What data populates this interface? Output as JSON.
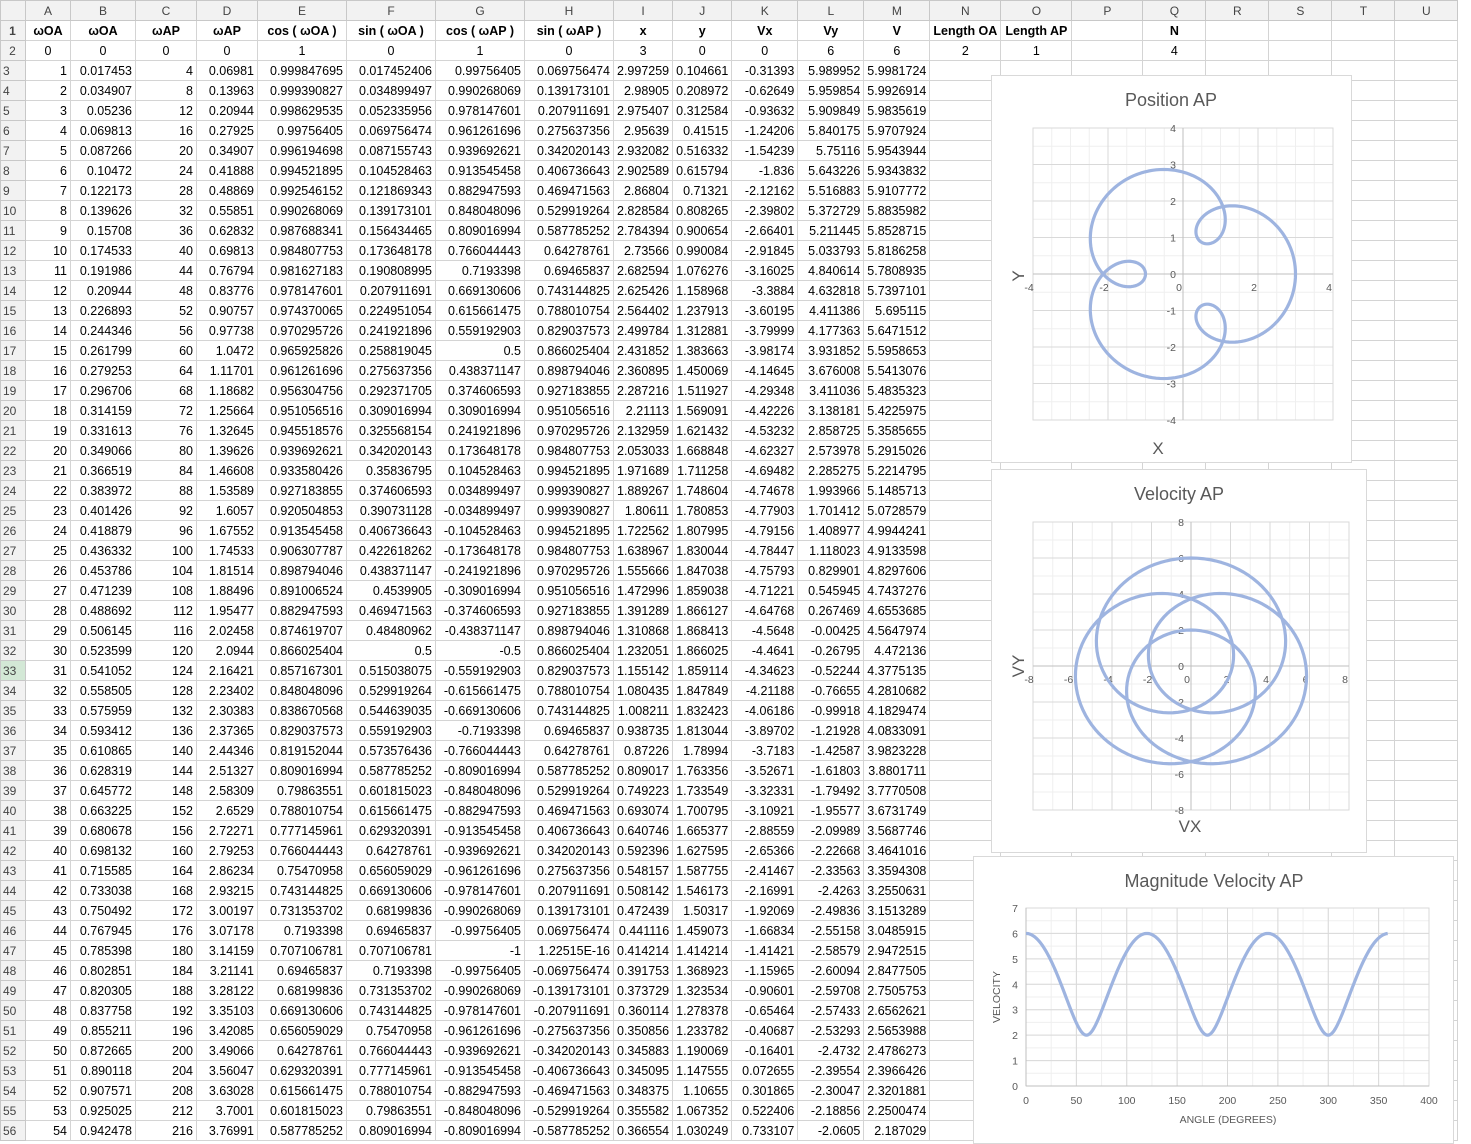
{
  "columns": [
    "A",
    "B",
    "C",
    "D",
    "E",
    "F",
    "G",
    "H",
    "I",
    "J",
    "K",
    "L",
    "M",
    "N",
    "O",
    "P",
    "Q",
    "R",
    "S",
    "T",
    "U"
  ],
  "selected_row": "33",
  "header_row": {
    "num": "1",
    "cells": [
      "ωOA",
      "ωOA",
      "ωAP",
      "ωAP",
      "cos ( ωOA )",
      "sin ( ωOA )",
      "cos ( ωAP )",
      "sin ( ωAP )",
      "x",
      "y",
      "Vx",
      "Vy",
      "V",
      "Length OA",
      "Length  AP",
      "",
      "N",
      "",
      "",
      "",
      ""
    ]
  },
  "row2": {
    "num": "2",
    "cells": [
      "0",
      "0",
      "0",
      "0",
      "1",
      "0",
      "1",
      "0",
      "3",
      "0",
      "0",
      "6",
      "6",
      "2",
      "1",
      "",
      "4",
      "",
      "",
      "",
      ""
    ]
  },
  "rows": [
    [
      "3",
      "1",
      "0.017453",
      "4",
      "0.06981",
      "0.999847695",
      "0.017452406",
      "0.99756405",
      "0.069756474",
      "2.997259",
      "0.104661",
      "-0.31393",
      "5.989952",
      "5.9981724"
    ],
    [
      "4",
      "2",
      "0.034907",
      "8",
      "0.13963",
      "0.999390827",
      "0.034899497",
      "0.990268069",
      "0.139173101",
      "2.98905",
      "0.208972",
      "-0.62649",
      "5.959854",
      "5.9926914"
    ],
    [
      "5",
      "3",
      "0.05236",
      "12",
      "0.20944",
      "0.998629535",
      "0.052335956",
      "0.978147601",
      "0.207911691",
      "2.975407",
      "0.312584",
      "-0.93632",
      "5.909849",
      "5.9835619"
    ],
    [
      "6",
      "4",
      "0.069813",
      "16",
      "0.27925",
      "0.99756405",
      "0.069756474",
      "0.961261696",
      "0.275637356",
      "2.95639",
      "0.41515",
      "-1.24206",
      "5.840175",
      "5.9707924"
    ],
    [
      "7",
      "5",
      "0.087266",
      "20",
      "0.34907",
      "0.996194698",
      "0.087155743",
      "0.939692621",
      "0.342020143",
      "2.932082",
      "0.516332",
      "-1.54239",
      "5.75116",
      "5.9543944"
    ],
    [
      "8",
      "6",
      "0.10472",
      "24",
      "0.41888",
      "0.994521895",
      "0.104528463",
      "0.913545458",
      "0.406736643",
      "2.902589",
      "0.615794",
      "-1.836",
      "5.643226",
      "5.9343832"
    ],
    [
      "9",
      "7",
      "0.122173",
      "28",
      "0.48869",
      "0.992546152",
      "0.121869343",
      "0.882947593",
      "0.469471563",
      "2.86804",
      "0.71321",
      "-2.12162",
      "5.516883",
      "5.9107772"
    ],
    [
      "10",
      "8",
      "0.139626",
      "32",
      "0.55851",
      "0.990268069",
      "0.139173101",
      "0.848048096",
      "0.529919264",
      "2.828584",
      "0.808265",
      "-2.39802",
      "5.372729",
      "5.8835982"
    ],
    [
      "11",
      "9",
      "0.15708",
      "36",
      "0.62832",
      "0.987688341",
      "0.156434465",
      "0.809016994",
      "0.587785252",
      "2.784394",
      "0.900654",
      "-2.66401",
      "5.211445",
      "5.8528715"
    ],
    [
      "12",
      "10",
      "0.174533",
      "40",
      "0.69813",
      "0.984807753",
      "0.173648178",
      "0.766044443",
      "0.64278761",
      "2.73566",
      "0.990084",
      "-2.91845",
      "5.033793",
      "5.8186258"
    ],
    [
      "13",
      "11",
      "0.191986",
      "44",
      "0.76794",
      "0.981627183",
      "0.190808995",
      "0.7193398",
      "0.69465837",
      "2.682594",
      "1.076276",
      "-3.16025",
      "4.840614",
      "5.7808935"
    ],
    [
      "14",
      "12",
      "0.20944",
      "48",
      "0.83776",
      "0.978147601",
      "0.207911691",
      "0.669130606",
      "0.743144825",
      "2.625426",
      "1.158968",
      "-3.3884",
      "4.632818",
      "5.7397101"
    ],
    [
      "15",
      "13",
      "0.226893",
      "52",
      "0.90757",
      "0.974370065",
      "0.224951054",
      "0.615661475",
      "0.788010754",
      "2.564402",
      "1.237913",
      "-3.60195",
      "4.411386",
      "5.695115"
    ],
    [
      "16",
      "14",
      "0.244346",
      "56",
      "0.97738",
      "0.970295726",
      "0.241921896",
      "0.559192903",
      "0.829037573",
      "2.499784",
      "1.312881",
      "-3.79999",
      "4.177363",
      "5.6471512"
    ],
    [
      "17",
      "15",
      "0.261799",
      "60",
      "1.0472",
      "0.965925826",
      "0.258819045",
      "0.5",
      "0.866025404",
      "2.431852",
      "1.383663",
      "-3.98174",
      "3.931852",
      "5.5958653"
    ],
    [
      "18",
      "16",
      "0.279253",
      "64",
      "1.11701",
      "0.961261696",
      "0.275637356",
      "0.438371147",
      "0.898794046",
      "2.360895",
      "1.450069",
      "-4.14645",
      "3.676008",
      "5.5413076"
    ],
    [
      "19",
      "17",
      "0.296706",
      "68",
      "1.18682",
      "0.956304756",
      "0.292371705",
      "0.374606593",
      "0.927183855",
      "2.287216",
      "1.511927",
      "-4.29348",
      "3.411036",
      "5.4835323"
    ],
    [
      "20",
      "18",
      "0.314159",
      "72",
      "1.25664",
      "0.951056516",
      "0.309016994",
      "0.309016994",
      "0.951056516",
      "2.21113",
      "1.569091",
      "-4.42226",
      "3.138181",
      "5.4225975"
    ],
    [
      "21",
      "19",
      "0.331613",
      "76",
      "1.32645",
      "0.945518576",
      "0.325568154",
      "0.241921896",
      "0.970295726",
      "2.132959",
      "1.621432",
      "-4.53232",
      "2.858725",
      "5.3585655"
    ],
    [
      "22",
      "20",
      "0.349066",
      "80",
      "1.39626",
      "0.939692621",
      "0.342020143",
      "0.173648178",
      "0.984807753",
      "2.053033",
      "1.668848",
      "-4.62327",
      "2.573978",
      "5.2915026"
    ],
    [
      "23",
      "21",
      "0.366519",
      "84",
      "1.46608",
      "0.933580426",
      "0.35836795",
      "0.104528463",
      "0.994521895",
      "1.971689",
      "1.711258",
      "-4.69482",
      "2.285275",
      "5.2214795"
    ],
    [
      "24",
      "22",
      "0.383972",
      "88",
      "1.53589",
      "0.927183855",
      "0.374606593",
      "0.034899497",
      "0.999390827",
      "1.889267",
      "1.748604",
      "-4.74678",
      "1.993966",
      "5.1485713"
    ],
    [
      "25",
      "23",
      "0.401426",
      "92",
      "1.6057",
      "0.920504853",
      "0.390731128",
      "-0.034899497",
      "0.999390827",
      "1.80611",
      "1.780853",
      "-4.77903",
      "1.701412",
      "5.0728579"
    ],
    [
      "26",
      "24",
      "0.418879",
      "96",
      "1.67552",
      "0.913545458",
      "0.406736643",
      "-0.104528463",
      "0.994521895",
      "1.722562",
      "1.807995",
      "-4.79156",
      "1.408977",
      "4.9944241"
    ],
    [
      "27",
      "25",
      "0.436332",
      "100",
      "1.74533",
      "0.906307787",
      "0.422618262",
      "-0.173648178",
      "0.984807753",
      "1.638967",
      "1.830044",
      "-4.78447",
      "1.118023",
      "4.9133598"
    ],
    [
      "28",
      "26",
      "0.453786",
      "104",
      "1.81514",
      "0.898794046",
      "0.438371147",
      "-0.241921896",
      "0.970295726",
      "1.555666",
      "1.847038",
      "-4.75793",
      "0.829901",
      "4.8297606"
    ],
    [
      "29",
      "27",
      "0.471239",
      "108",
      "1.88496",
      "0.891006524",
      "0.4539905",
      "-0.309016994",
      "0.951056516",
      "1.472996",
      "1.859038",
      "-4.71221",
      "0.545945",
      "4.7437276"
    ],
    [
      "30",
      "28",
      "0.488692",
      "112",
      "1.95477",
      "0.882947593",
      "0.469471563",
      "-0.374606593",
      "0.927183855",
      "1.391289",
      "1.866127",
      "-4.64768",
      "0.267469",
      "4.6553685"
    ],
    [
      "31",
      "29",
      "0.506145",
      "116",
      "2.02458",
      "0.874619707",
      "0.48480962",
      "-0.438371147",
      "0.898794046",
      "1.310868",
      "1.868413",
      "-4.5648",
      "-0.00425",
      "4.5647974"
    ],
    [
      "32",
      "30",
      "0.523599",
      "120",
      "2.0944",
      "0.866025404",
      "0.5",
      "-0.5",
      "0.866025404",
      "1.232051",
      "1.866025",
      "-4.4641",
      "-0.26795",
      "4.472136"
    ],
    [
      "33",
      "31",
      "0.541052",
      "124",
      "2.16421",
      "0.857167301",
      "0.515038075",
      "-0.559192903",
      "0.829037573",
      "1.155142",
      "1.859114",
      "-4.34623",
      "-0.52244",
      "4.3775135"
    ],
    [
      "34",
      "32",
      "0.558505",
      "128",
      "2.23402",
      "0.848048096",
      "0.529919264",
      "-0.615661475",
      "0.788010754",
      "1.080435",
      "1.847849",
      "-4.21188",
      "-0.76655",
      "4.2810682"
    ],
    [
      "35",
      "33",
      "0.575959",
      "132",
      "2.30383",
      "0.838670568",
      "0.544639035",
      "-0.669130606",
      "0.743144825",
      "1.008211",
      "1.832423",
      "-4.06186",
      "-0.99918",
      "4.1829474"
    ],
    [
      "36",
      "34",
      "0.593412",
      "136",
      "2.37365",
      "0.829037573",
      "0.559192903",
      "-0.7193398",
      "0.69465837",
      "0.938735",
      "1.813044",
      "-3.89702",
      "-1.21928",
      "4.0833091"
    ],
    [
      "37",
      "35",
      "0.610865",
      "140",
      "2.44346",
      "0.819152044",
      "0.573576436",
      "-0.766044443",
      "0.64278761",
      "0.87226",
      "1.78994",
      "-3.7183",
      "-1.42587",
      "3.9823228"
    ],
    [
      "38",
      "36",
      "0.628319",
      "144",
      "2.51327",
      "0.809016994",
      "0.587785252",
      "-0.809016994",
      "0.587785252",
      "0.809017",
      "1.763356",
      "-3.52671",
      "-1.61803",
      "3.8801711"
    ],
    [
      "39",
      "37",
      "0.645772",
      "148",
      "2.58309",
      "0.79863551",
      "0.601815023",
      "-0.848048096",
      "0.529919264",
      "0.749223",
      "1.733549",
      "-3.32331",
      "-1.79492",
      "3.7770508"
    ],
    [
      "40",
      "38",
      "0.663225",
      "152",
      "2.6529",
      "0.788010754",
      "0.615661475",
      "-0.882947593",
      "0.469471563",
      "0.693074",
      "1.700795",
      "-3.10921",
      "-1.95577",
      "3.6731749"
    ],
    [
      "41",
      "39",
      "0.680678",
      "156",
      "2.72271",
      "0.777145961",
      "0.629320391",
      "-0.913545458",
      "0.406736643",
      "0.640746",
      "1.665377",
      "-2.88559",
      "-2.09989",
      "3.5687746"
    ],
    [
      "42",
      "40",
      "0.698132",
      "160",
      "2.79253",
      "0.766044443",
      "0.64278761",
      "-0.939692621",
      "0.342020143",
      "0.592396",
      "1.627595",
      "-2.65366",
      "-2.22668",
      "3.4641016"
    ],
    [
      "43",
      "41",
      "0.715585",
      "164",
      "2.86234",
      "0.75470958",
      "0.656059029",
      "-0.961261696",
      "0.275637356",
      "0.548157",
      "1.587755",
      "-2.41467",
      "-2.33563",
      "3.3594308"
    ],
    [
      "44",
      "42",
      "0.733038",
      "168",
      "2.93215",
      "0.743144825",
      "0.669130606",
      "-0.978147601",
      "0.207911691",
      "0.508142",
      "1.546173",
      "-2.16991",
      "-2.4263",
      "3.2550631"
    ],
    [
      "45",
      "43",
      "0.750492",
      "172",
      "3.00197",
      "0.731353702",
      "0.68199836",
      "-0.990268069",
      "0.139173101",
      "0.472439",
      "1.50317",
      "-1.92069",
      "-2.49836",
      "3.1513289"
    ],
    [
      "46",
      "44",
      "0.767945",
      "176",
      "3.07178",
      "0.7193398",
      "0.69465837",
      "-0.99756405",
      "0.069756474",
      "0.441116",
      "1.459073",
      "-1.66834",
      "-2.55158",
      "3.0485915"
    ],
    [
      "47",
      "45",
      "0.785398",
      "180",
      "3.14159",
      "0.707106781",
      "0.707106781",
      "-1",
      "1.22515E-16",
      "0.414214",
      "1.414214",
      "-1.41421",
      "-2.58579",
      "2.9472515"
    ],
    [
      "48",
      "46",
      "0.802851",
      "184",
      "3.21141",
      "0.69465837",
      "0.7193398",
      "-0.99756405",
      "-0.069756474",
      "0.391753",
      "1.368923",
      "-1.15965",
      "-2.60094",
      "2.8477505"
    ],
    [
      "49",
      "47",
      "0.820305",
      "188",
      "3.28122",
      "0.68199836",
      "0.731353702",
      "-0.990268069",
      "-0.139173101",
      "0.373729",
      "1.323534",
      "-0.90601",
      "-2.59708",
      "2.7505753"
    ],
    [
      "50",
      "48",
      "0.837758",
      "192",
      "3.35103",
      "0.669130606",
      "0.743144825",
      "-0.978147601",
      "-0.207911691",
      "0.360114",
      "1.278378",
      "-0.65464",
      "-2.57433",
      "2.6562621"
    ],
    [
      "51",
      "49",
      "0.855211",
      "196",
      "3.42085",
      "0.656059029",
      "0.75470958",
      "-0.961261696",
      "-0.275637356",
      "0.350856",
      "1.233782",
      "-0.40687",
      "-2.53293",
      "2.5653988"
    ],
    [
      "52",
      "50",
      "0.872665",
      "200",
      "3.49066",
      "0.64278761",
      "0.766044443",
      "-0.939692621",
      "-0.342020143",
      "0.345883",
      "1.190069",
      "-0.16401",
      "-2.4732",
      "2.4786273"
    ],
    [
      "53",
      "51",
      "0.890118",
      "204",
      "3.56047",
      "0.629320391",
      "0.777145961",
      "-0.913545458",
      "-0.406736643",
      "0.345095",
      "1.147555",
      "0.072655",
      "-2.39554",
      "2.3966426"
    ],
    [
      "54",
      "52",
      "0.907571",
      "208",
      "3.63028",
      "0.615661475",
      "0.788010754",
      "-0.882947593",
      "-0.469471563",
      "0.348375",
      "1.10655",
      "0.301865",
      "-2.30047",
      "2.3201881"
    ],
    [
      "55",
      "53",
      "0.925025",
      "212",
      "3.7001",
      "0.601815023",
      "0.79863551",
      "-0.848048096",
      "-0.529919264",
      "0.355582",
      "1.067352",
      "0.522406",
      "-2.18856",
      "2.2500474"
    ],
    [
      "56",
      "54",
      "0.942478",
      "216",
      "3.76991",
      "0.587785252",
      "0.809016994",
      "-0.809016994",
      "-0.587785252",
      "0.366554",
      "1.030249",
      "0.733107",
      "-2.0605",
      "2.187029"
    ]
  ],
  "colors": {
    "series": "#9eb4e0",
    "grid_minor": "#efefef",
    "grid_major": "#d9d9d9",
    "axis": "#bfbfbf",
    "title": "#595959"
  },
  "charts": {
    "position": {
      "chart_data": {
        "type": "scatter",
        "title": "Position AP",
        "xlabel": "X",
        "ylabel": "Y",
        "xlim": [
          -4,
          4
        ],
        "ylim": [
          -4,
          4
        ],
        "grid": true,
        "xticks": [
          "-4",
          "-2",
          "0",
          "2",
          "4"
        ],
        "yticks": [
          "-4",
          "-3",
          "-2",
          "-1",
          "0",
          "1",
          "2",
          "3",
          "4"
        ],
        "series": [
          {
            "equation": "x = 2cos(θ) + cos(4θ), y = 2sin(θ) + sin(4θ)",
            "theta_deg": [
              0,
              360
            ]
          }
        ]
      }
    },
    "velocity": {
      "chart_data": {
        "type": "scatter",
        "title": "Velocity AP",
        "xlabel": "VX",
        "ylabel": "VY",
        "xlim": [
          -8,
          8
        ],
        "ylim": [
          -8,
          8
        ],
        "grid": true,
        "xticks": [
          "-8",
          "-6",
          "-4",
          "-2",
          "0",
          "2",
          "4",
          "6",
          "8"
        ],
        "yticks": [
          "-8",
          "-6",
          "-4",
          "-2",
          "0",
          "2",
          "4",
          "6",
          "8"
        ],
        "series": [
          {
            "equation": "Vx = -2sin(θ) - 4sin(4θ), Vy = 2cos(θ) + 4cos(4θ)",
            "theta_deg": [
              0,
              360
            ]
          }
        ]
      }
    },
    "magnitude": {
      "chart_data": {
        "type": "line",
        "title": "Magnitude Velocity AP",
        "xlabel": "ANGLE (DEGREES)",
        "ylabel": "VELOCITY",
        "xlim": [
          0,
          400
        ],
        "ylim": [
          0,
          7
        ],
        "grid": true,
        "xticks": [
          "0",
          "50",
          "100",
          "150",
          "200",
          "250",
          "300",
          "350",
          "400"
        ],
        "yticks": [
          "0",
          "1",
          "2",
          "3",
          "4",
          "5",
          "6",
          "7"
        ],
        "series": [
          {
            "equation": "V = sqrt(20 + 16cos(3θ))",
            "theta_deg": [
              0,
              359
            ]
          }
        ]
      }
    }
  }
}
